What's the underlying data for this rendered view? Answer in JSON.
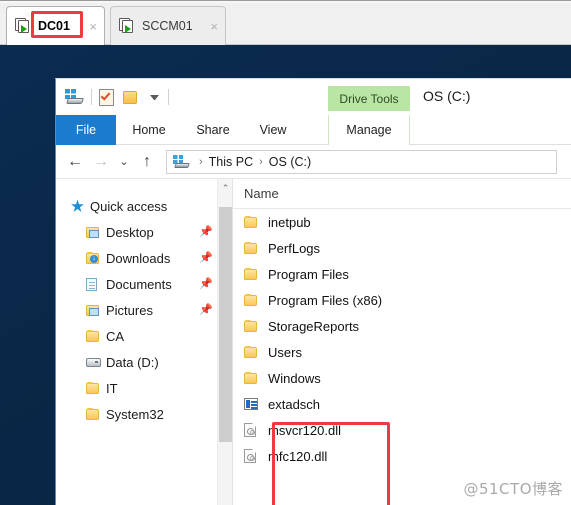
{
  "console_tabs": {
    "tabs": [
      {
        "label": "DC01",
        "icon": "vm-running-icon",
        "close": "×",
        "active": true,
        "highlighted": true
      },
      {
        "label": "SCCM01",
        "icon": "vm-running-icon",
        "close": "×",
        "active": false,
        "highlighted": false
      }
    ]
  },
  "explorer": {
    "quick_access_toolbar": {
      "drive_icon": "drive-icon",
      "properties_icon": "properties-icon",
      "new_folder_icon": "new-folder-icon",
      "customize_caret": "chevron-down-icon"
    },
    "contextual_tab_group": "Drive Tools",
    "window_title": "OS (C:)",
    "ribbon_tabs": [
      {
        "label": "File",
        "state": "file-menu"
      },
      {
        "label": "Home",
        "state": "normal"
      },
      {
        "label": "Share",
        "state": "normal"
      },
      {
        "label": "View",
        "state": "normal"
      },
      {
        "label": "Manage",
        "state": "contextual"
      }
    ],
    "navbar": {
      "back_icon": "←",
      "forward_icon": "→",
      "recent_icon": "⌄",
      "up_icon": "↑",
      "breadcrumb": [
        "This PC",
        "OS (C:)"
      ],
      "separator": "›",
      "drive_icon": "this-pc-icon"
    },
    "nav_pane": {
      "items": [
        {
          "label": "Quick access",
          "icon": "quick-access-star-icon",
          "indent": false,
          "pinned": false
        },
        {
          "label": "Desktop",
          "icon": "desktop-icon",
          "indent": true,
          "pinned": true
        },
        {
          "label": "Downloads",
          "icon": "downloads-icon",
          "indent": true,
          "pinned": true
        },
        {
          "label": "Documents",
          "icon": "documents-icon",
          "indent": true,
          "pinned": true
        },
        {
          "label": "Pictures",
          "icon": "pictures-icon",
          "indent": true,
          "pinned": true
        },
        {
          "label": "CA",
          "icon": "folder-icon",
          "indent": true,
          "pinned": false
        },
        {
          "label": "Data (D:)",
          "icon": "drive-icon",
          "indent": true,
          "pinned": false
        },
        {
          "label": "IT",
          "icon": "folder-icon",
          "indent": true,
          "pinned": false
        },
        {
          "label": "System32",
          "icon": "folder-icon",
          "indent": true,
          "pinned": false
        }
      ],
      "scrollbar": {
        "up_arrow": "⌃"
      }
    },
    "file_list": {
      "column_header": "Name",
      "sort_caret": "⌃",
      "rows": [
        {
          "name": "inetpub",
          "icon": "folder-icon",
          "selected": false
        },
        {
          "name": "PerfLogs",
          "icon": "folder-icon",
          "selected": false
        },
        {
          "name": "Program Files",
          "icon": "folder-icon",
          "selected": false
        },
        {
          "name": "Program Files (x86)",
          "icon": "folder-icon",
          "selected": false
        },
        {
          "name": "StorageReports",
          "icon": "folder-icon",
          "selected": false
        },
        {
          "name": "Users",
          "icon": "folder-icon",
          "selected": false
        },
        {
          "name": "Windows",
          "icon": "folder-icon",
          "selected": false
        },
        {
          "name": "extadsch",
          "icon": "application-icon",
          "selected": false
        },
        {
          "name": "msvcr120.dll",
          "icon": "dll-file-icon",
          "selected": false
        },
        {
          "name": "mfc120.dll",
          "icon": "dll-file-icon",
          "selected": false
        }
      ]
    }
  },
  "annotations": {
    "highlight_color": "#ef3b3b",
    "dc01_tab_box": true,
    "files_box": true
  },
  "watermark": "@51CTO博客",
  "colors": {
    "desktop": "#0a2747",
    "file_tab_blue": "#1a7bcf",
    "drive_tools_green": "#b9e6a4",
    "selection_blue": "#cde8ff"
  }
}
